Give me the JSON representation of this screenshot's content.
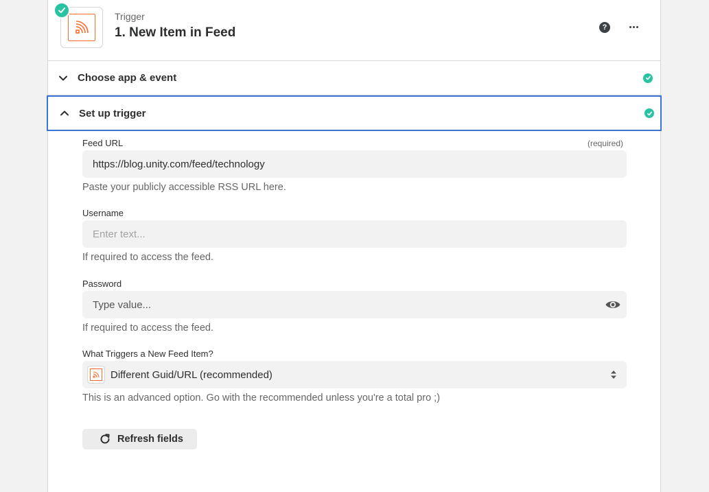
{
  "step": {
    "kicker": "Trigger",
    "title": "1. New Item in Feed",
    "help_glyph": "?"
  },
  "sections": {
    "choose_app": "Choose app & event",
    "setup_trigger": "Set up trigger"
  },
  "fields": {
    "feed_url": {
      "label": "Feed URL",
      "required": "(required)",
      "value": "https://blog.unity.com/feed/technology",
      "help": "Paste your publicly accessible RSS URL here."
    },
    "username": {
      "label": "Username",
      "placeholder": "Enter text...",
      "help": "If required to access the feed."
    },
    "password": {
      "label": "Password",
      "placeholder": "Type value...",
      "help": "If required to access the feed."
    },
    "trigger_type": {
      "label": "What Triggers a New Feed Item?",
      "selected": "Different Guid/URL (recommended)",
      "help": "This is an advanced option. Go with the recommended unless you're a total pro ;)"
    }
  },
  "refresh_label": "Refresh fields",
  "colors": {
    "accent_blue": "#3b73d9",
    "success": "#2ac3a2",
    "rss_orange": "#ff6b2b"
  },
  "icons": [
    "rss-icon",
    "check-icon",
    "help-icon",
    "more-icon",
    "chevron-down-icon",
    "chevron-up-icon",
    "eye-icon",
    "select-arrows-icon",
    "refresh-icon"
  ]
}
